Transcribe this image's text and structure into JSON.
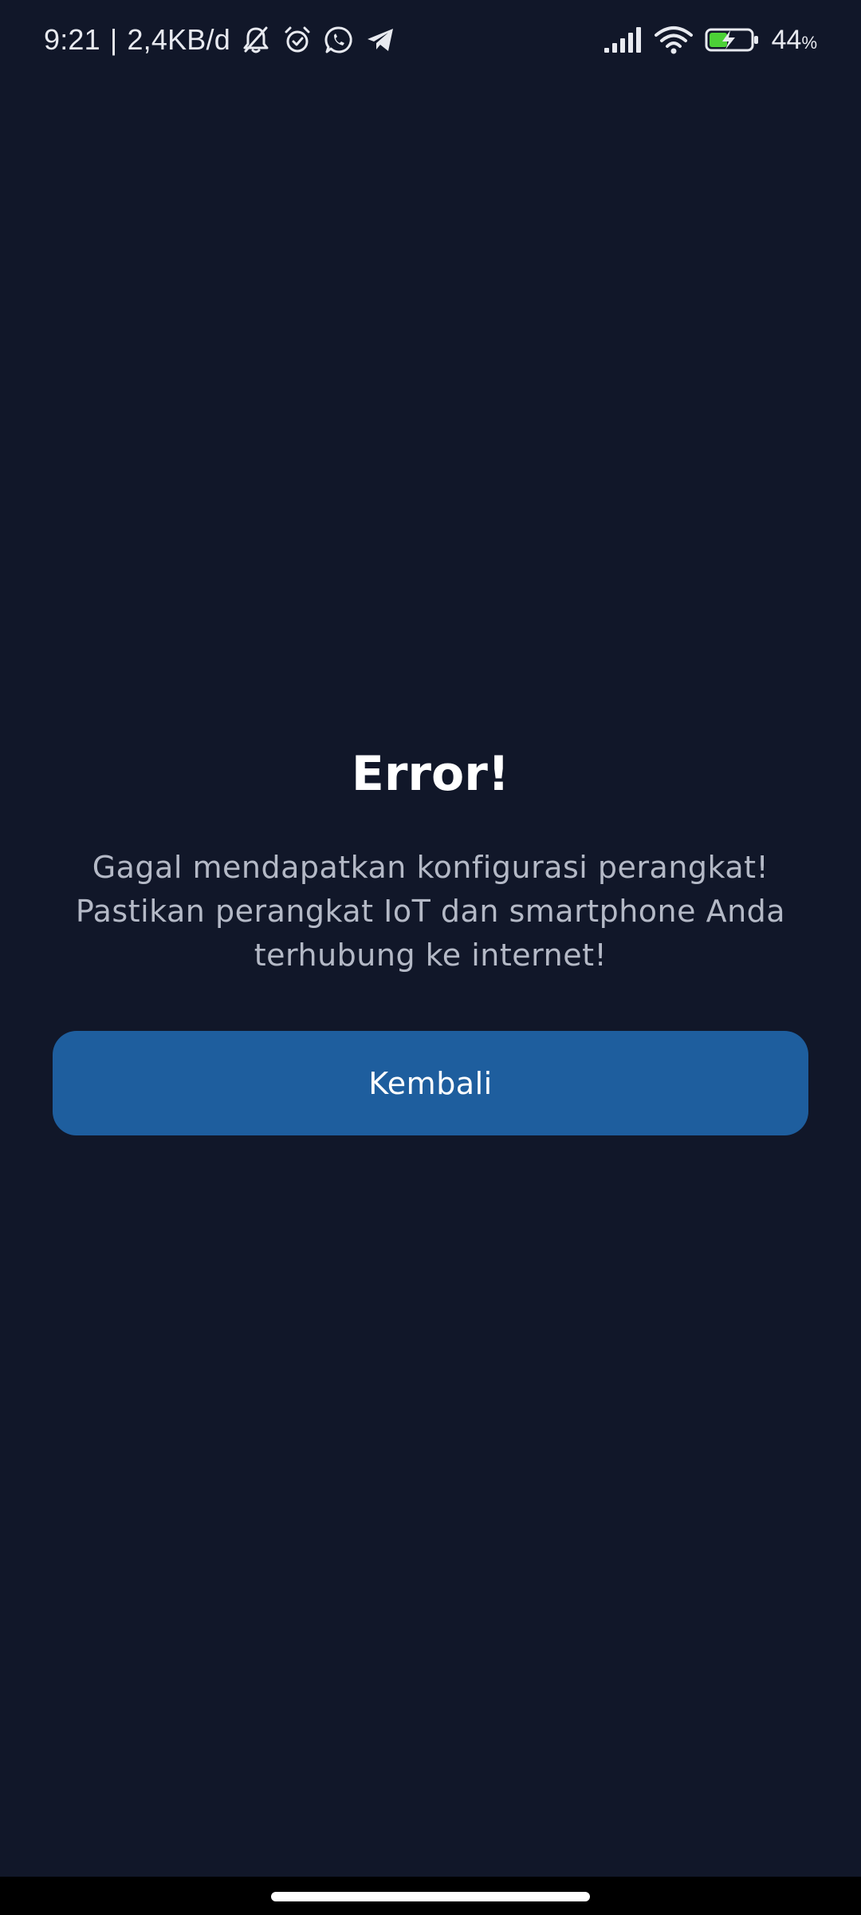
{
  "status_bar": {
    "time": "9:21",
    "separator": "|",
    "data_speed": "2,4KB/d",
    "battery_percent": "44",
    "battery_sign": "%",
    "battery_level": 0.44,
    "icons": {
      "left": [
        "muted-bell-icon",
        "alarm-clock-icon",
        "whatsapp-icon",
        "telegram-icon"
      ],
      "right": [
        "signal-icon",
        "wifi-icon",
        "battery-charging-icon"
      ]
    },
    "colors": {
      "text": "#e8eaf0",
      "battery_fill": "#4cd137"
    }
  },
  "main": {
    "title": "Error!",
    "message": "Gagal mendapatkan konfigurasi perangkat! Pastikan perangkat IoT dan smartphone Anda terhubung ke internet!",
    "back_button_label": "Kembali"
  },
  "colors": {
    "background": "#111729",
    "button": "#1e5e9e",
    "title_text": "#ffffff",
    "message_text": "#b4b9c6"
  }
}
